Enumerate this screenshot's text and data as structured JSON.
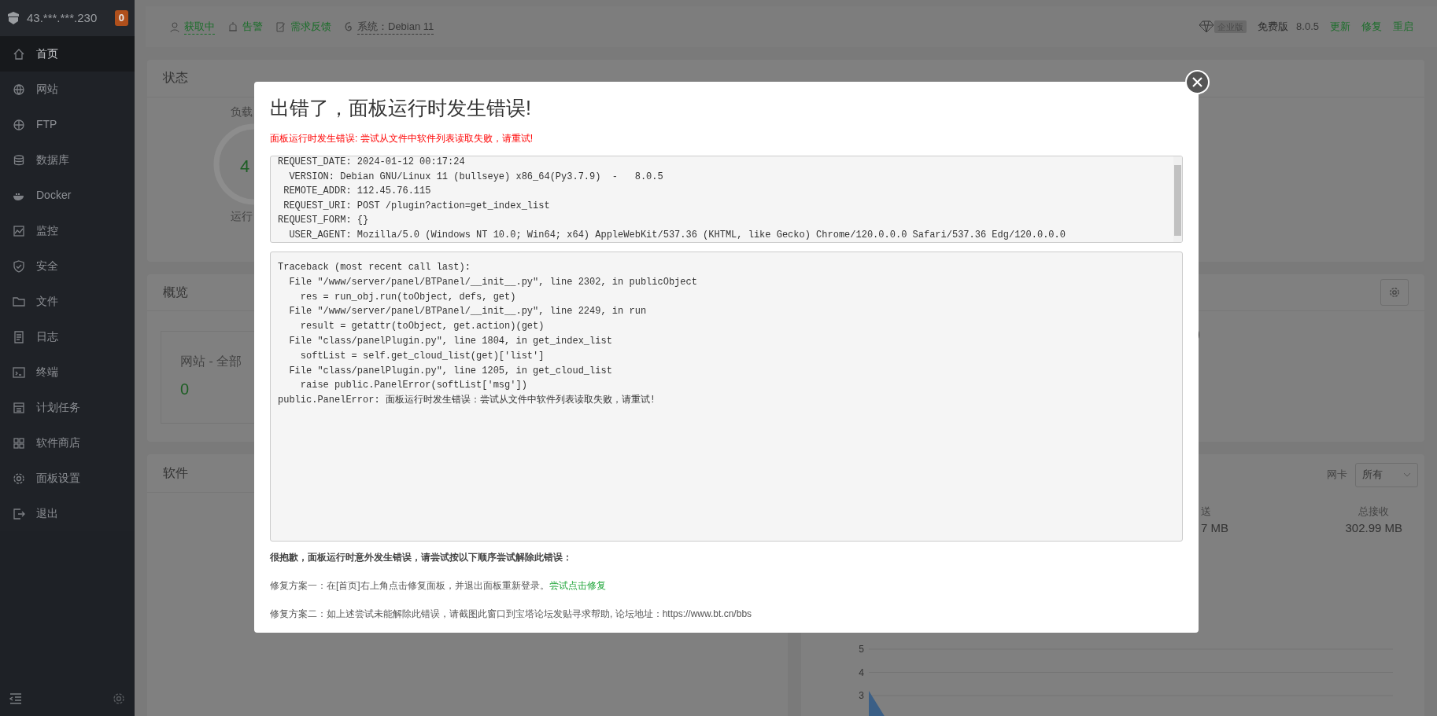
{
  "sidebar": {
    "host": "43.***.***.230",
    "badge": "0",
    "items": [
      {
        "label": "首页",
        "selected": true
      },
      {
        "label": "网站",
        "selected": false
      },
      {
        "label": "FTP",
        "selected": false
      },
      {
        "label": "数据库",
        "selected": false
      },
      {
        "label": "Docker",
        "selected": false
      },
      {
        "label": "监控",
        "selected": false
      },
      {
        "label": "安全",
        "selected": false
      },
      {
        "label": "文件",
        "selected": false
      },
      {
        "label": "日志",
        "selected": false
      },
      {
        "label": "终端",
        "selected": false
      },
      {
        "label": "计划任务",
        "selected": false
      },
      {
        "label": "软件商店",
        "selected": false
      },
      {
        "label": "面板设置",
        "selected": false
      },
      {
        "label": "退出",
        "selected": false
      }
    ]
  },
  "topbar": {
    "links": [
      "获取中",
      "告警",
      "需求反馈"
    ],
    "system_label": "系统：",
    "system_value": "Debian 11",
    "edition_badge": "企业版",
    "edition": "免费版",
    "version": "8.0.5",
    "actions": [
      "更新",
      "修复",
      "重启"
    ]
  },
  "status": {
    "title": "状态",
    "gauge_label": "负载",
    "gauge_value": "4",
    "gauge_caption": "运行"
  },
  "overview": {
    "title": "概览",
    "site_label": "网站 - 全部",
    "site_count": "0"
  },
  "software": {
    "title": "软件"
  },
  "traffic": {
    "nic_label": "网卡",
    "nic_select": "所有",
    "sent_label": "送",
    "sent": "7 MB",
    "received_label": "总接收",
    "received": "302.99 MB",
    "chart_tick_labels": [
      "5",
      "4",
      "3"
    ]
  },
  "modal": {
    "title": "出错了，面板运行时发生错误!",
    "error": "面板运行时发生错误: 尝试从文件中软件列表读取失败，请重试!",
    "request_info": [
      "REQUEST_DATE: 2024-01-12 00:17:24",
      "  VERSION: Debian GNU/Linux 11 (bullseye) x86_64(Py3.7.9)  -   8.0.5",
      " REMOTE_ADDR: 112.45.76.115",
      " REQUEST_URI: POST /plugin?action=get_index_list",
      "REQUEST_FORM: {}",
      "  USER_AGENT: Mozilla/5.0 (Windows NT 10.0; Win64; x64) AppleWebKit/537.36 (KHTML, like Gecko) Chrome/120.0.0.0 Safari/537.36 Edg/120.0.0.0"
    ],
    "traceback": [
      "Traceback (most recent call last):",
      "  File \"/www/server/panel/BTPanel/__init__.py\", line 2302, in publicObject",
      "    res = run_obj.run(toObject, defs, get)",
      "  File \"/www/server/panel/BTPanel/__init__.py\", line 2249, in run",
      "    result = getattr(toObject, get.action)(get)",
      "  File \"class/panelPlugin.py\", line 1804, in get_index_list",
      "    softList = self.get_cloud_list(get)['list']",
      "  File \"class/panelPlugin.py\", line 1205, in get_cloud_list",
      "    raise public.PanelError(softList['msg'])",
      "public.PanelError: 面板运行时发生错误：尝试从文件中软件列表读取失败，请重试!"
    ],
    "apology": "很抱歉，面板运行时意外发生错误，请尝试按以下顺序尝试解除此错误：",
    "fixes": [
      {
        "text": "修复方案一：在[首页]右上角点击修复面板，并退出面板重新登录。",
        "link": "尝试点击修复"
      },
      {
        "text": "修复方案二：如上述尝试未能解除此错误，请截图此窗口到宝塔论坛发贴寻求帮助, 论坛地址：https://www.bt.cn/bbs"
      }
    ]
  }
}
